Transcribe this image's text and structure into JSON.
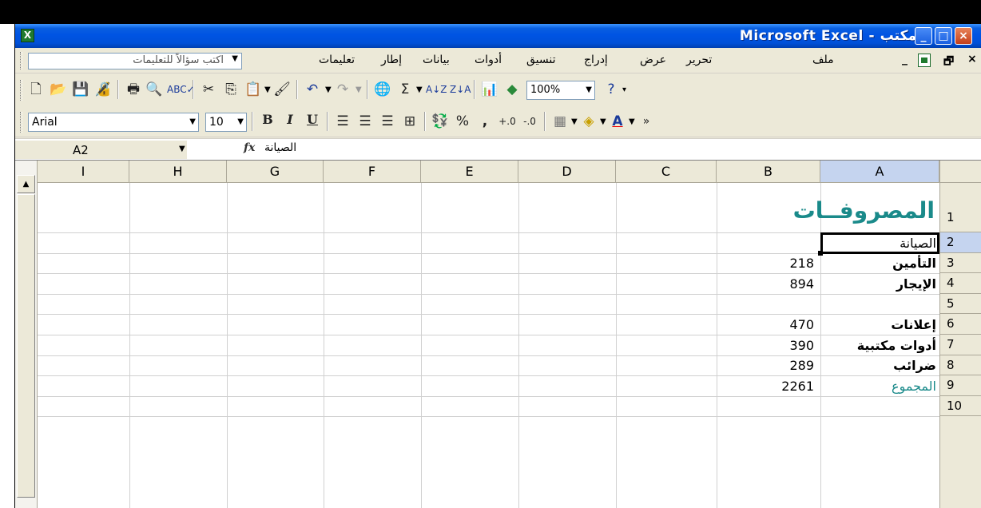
{
  "window": {
    "title": "Microsoft Excel - مكتب",
    "buttons": {
      "minimize": "_",
      "maximize": "□",
      "close": "×"
    }
  },
  "menubar": {
    "ask_placeholder": "اكتب سؤالاً للتعليمات",
    "items": [
      "ملف",
      "تحرير",
      "عرض",
      "إدراج",
      "تنسيق",
      "أدوات",
      "بيانات",
      "إطار",
      "تعليمات"
    ],
    "mdi_close": "×",
    "mdi_restore": "🗗",
    "mdi_minimize": "_"
  },
  "toolbar_standard": {
    "zoom": "100%",
    "icons": [
      "new-icon",
      "open-icon",
      "save-icon",
      "permission-icon",
      "print-icon",
      "print-preview-icon",
      "spelling-icon",
      "cut-icon",
      "copy-icon",
      "paste-icon",
      "format-painter-icon",
      "undo-icon",
      "redo-icon",
      "hyperlink-icon",
      "autosum-icon",
      "sort-ascending-icon",
      "sort-descending-icon",
      "chart-wizard-icon",
      "drawing-icon",
      "help-icon"
    ]
  },
  "toolbar_formatting": {
    "font_name": "Arial",
    "font_size": "10",
    "bold": "B",
    "italic": "I",
    "underline": "U",
    "percent": "%",
    "comma": ",",
    "font_color_label": "A",
    "more": "»"
  },
  "formula_bar": {
    "name_box": "A2",
    "fx": "fx",
    "content": "الصيانة"
  },
  "sheet": {
    "columns": [
      "I",
      "H",
      "G",
      "F",
      "E",
      "D",
      "C",
      "B",
      "A"
    ],
    "active_column": "A",
    "rows": [
      "1",
      "2",
      "3",
      "4",
      "5",
      "6",
      "7",
      "8",
      "9",
      "10"
    ],
    "active_row": "2",
    "title": "المصروفــات",
    "col_a": [
      "",
      "الصيانة",
      "التأمين",
      "الإيجار",
      "",
      "إعلانات",
      "أدوات مكتبية",
      "ضرائب",
      "المجموع",
      ""
    ],
    "col_b": [
      "",
      "",
      "218",
      "894",
      "",
      "470",
      "390",
      "289",
      "2261",
      ""
    ],
    "colors": {
      "title": "#1a8a8a",
      "total_label": "#1a8a8a",
      "selection_header": "#c5d4ef"
    }
  }
}
